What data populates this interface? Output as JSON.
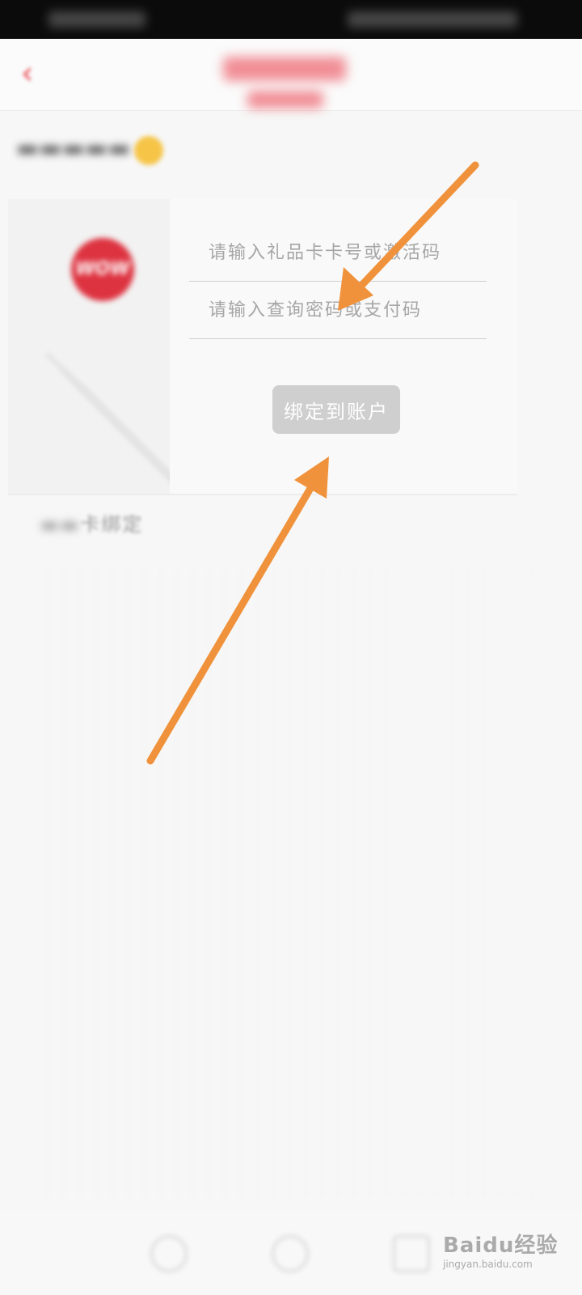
{
  "gift_card_form": {
    "card_number_placeholder": "请输入礼品卡卡号或激活码",
    "password_placeholder": "请输入查询密码或支付码",
    "bind_button_label": "绑定到账户"
  },
  "partial_label": {
    "visible_text": "卡绑定"
  },
  "logo": {
    "text": "WOW"
  },
  "watermark": {
    "brand": "Baidu经验",
    "url": "jingyan.baidu.com"
  },
  "colors": {
    "accent": "#e8424a",
    "arrow": "#f0923b",
    "button_bg": "#cfcfcf"
  },
  "icons": {
    "back": "chevron-left-icon",
    "coin": "coin-icon"
  }
}
